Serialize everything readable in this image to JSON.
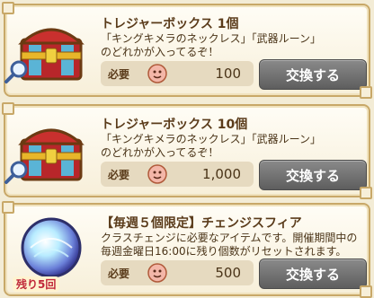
{
  "items": [
    {
      "title": "トレジャーボックス 1個",
      "desc": "「キングキメラのネックレス」「武器ルーン」\nのどれかが入ってるぞ！",
      "need_label": "必要",
      "amount": "100",
      "button_label": "交換する"
    },
    {
      "title": "トレジャーボックス 10個",
      "desc": "「キングキメラのネックレス」「武器ルーン」\nのどれかが入ってるぞ！",
      "need_label": "必要",
      "amount": "1,000",
      "button_label": "交換する"
    },
    {
      "title": "【毎週５個限定】チェンジスフィア",
      "desc": "クラスチェンジに必要なアイテムです。開催期間中の\n毎週金曜日16:00に残り個数がリセットされます。",
      "need_label": "必要",
      "amount": "500",
      "button_label": "交換する",
      "remaining": "残り5回"
    }
  ]
}
